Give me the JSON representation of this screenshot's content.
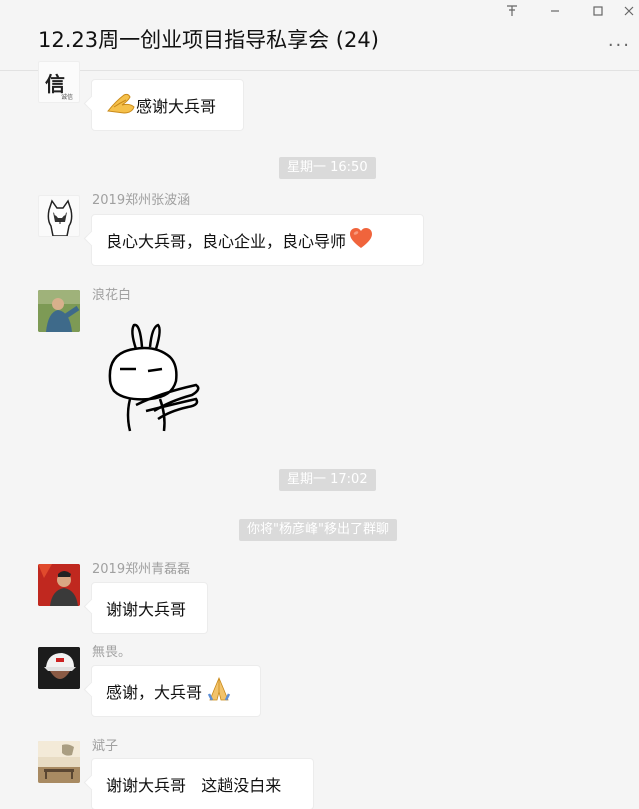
{
  "window": {
    "title": "12.23周一创业项目指导私享会 (24)",
    "controls": {
      "pin": "⊤",
      "minimize": "—",
      "maximize": "☐",
      "close": "✕"
    },
    "more": "..."
  },
  "messages": [
    {
      "sender": "",
      "text": "感谢大兵哥",
      "emoji": "bow-emoji"
    },
    {
      "sender": "2019郑州张波涵",
      "text": "良心大兵哥，良心企业，良心导师",
      "emoji": "heart-emoji"
    },
    {
      "sender": "浪花白",
      "sticker": "rabbit-bow-sticker"
    },
    {
      "sender": "2019郑州青磊磊",
      "text": "谢谢大兵哥"
    },
    {
      "sender": "無畏。",
      "text": "感谢，大兵哥",
      "emoji": "pray-emoji"
    },
    {
      "sender": "斌子",
      "text": "谢谢大兵哥   这趟没白来"
    }
  ],
  "system": {
    "time1": "星期一 16:50",
    "time2": "星期一 17:02",
    "notice": "你将\"杨彦峰\"移出了群聊"
  },
  "avatar_text": {
    "first": "信",
    "first_small": "诚信"
  },
  "colors": {
    "background": "#f5f5f5",
    "bubble": "#ffffff",
    "system_pill": "#dadada",
    "sender_name": "#a0a0a0",
    "heart": "#f0643c"
  }
}
